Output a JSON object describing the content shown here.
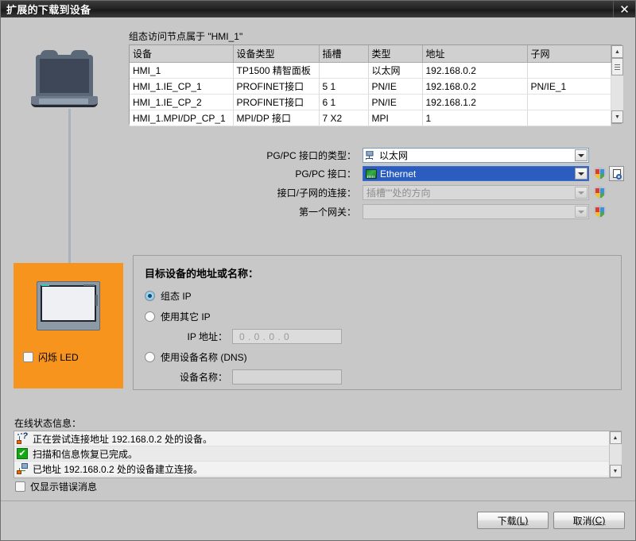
{
  "window": {
    "title": "扩展的下载到设备",
    "close_label": "✕",
    "close_icon": "close-icon"
  },
  "access_nodes": {
    "caption": "组态访问节点属于 \"HMI_1\"",
    "columns": [
      "设备",
      "设备类型",
      "插槽",
      "类型",
      "地址",
      "子网"
    ],
    "rows": [
      {
        "device": "HMI_1",
        "type": "TP1500 精智面板",
        "slot": "",
        "conn": "以太网",
        "address": "192.168.0.2",
        "subnet": ""
      },
      {
        "device": "HMI_1.IE_CP_1",
        "type": "PROFINET接口",
        "slot": "5 1",
        "conn": "PN/IE",
        "address": "192.168.0.2",
        "subnet": "PN/IE_1"
      },
      {
        "device": "HMI_1.IE_CP_2",
        "type": "PROFINET接口",
        "slot": "6 1",
        "conn": "PN/IE",
        "address": "192.168.1.2",
        "subnet": ""
      },
      {
        "device": "HMI_1.MPI/DP_CP_1",
        "type": "MPI/DP 接口",
        "slot": "7 X2",
        "conn": "MPI",
        "address": "1",
        "subnet": ""
      }
    ]
  },
  "interface": {
    "type_label": "PG/PC 接口的类型：",
    "type_value": "以太网",
    "type_icon": "network-node-icon",
    "pgpc_label": "PG/PC 接口：",
    "pgpc_value": "Ethernet",
    "pgpc_icon": "network-card-icon",
    "subnet_label": "接口/子网的连接：",
    "subnet_value": "插槽\"\"处的方向",
    "gateway_label": "第一个网关：",
    "gateway_value": "",
    "shield_icon": "security-shield-icon",
    "browse_icon": "browse-magnifier-icon"
  },
  "panel": {
    "flash_led_label": "闪烁 LED",
    "flash_led_checked": false,
    "device_icon": "hmi-panel-icon",
    "pc_icon": "laptop-icon"
  },
  "target": {
    "group_title": "目标设备的地址或名称：",
    "option_configured_ip": "组态 IP",
    "option_other_ip": "使用其它 IP",
    "option_dns": "使用设备名称 (DNS)",
    "selected": "组态 IP",
    "ip_label": "IP 地址：",
    "ip_value": "0    . 0    . 0    . 0",
    "name_label": "设备名称：",
    "name_value": ""
  },
  "status": {
    "title": "在线状态信息：",
    "messages": [
      {
        "icon": "network-search-icon",
        "text": "正在尝试连接地址 192.168.0.2 处的设备。"
      },
      {
        "icon": "success-check-icon",
        "text": "扫描和信息恢复已完成。"
      },
      {
        "icon": "connection-established-icon",
        "text": "已地址 192.168.0.2 处的设备建立连接。"
      }
    ],
    "errors_only_label": "仅显示错误消息",
    "errors_only_checked": false
  },
  "footer": {
    "download_label": "下载",
    "download_accel": "(L)",
    "cancel_label": "取消",
    "cancel_accel": "(C)"
  },
  "colors": {
    "accent_orange": "#f7941e",
    "select_blue": "#2b5dc0",
    "success_green": "#14a814",
    "titlebar": "#242424"
  }
}
